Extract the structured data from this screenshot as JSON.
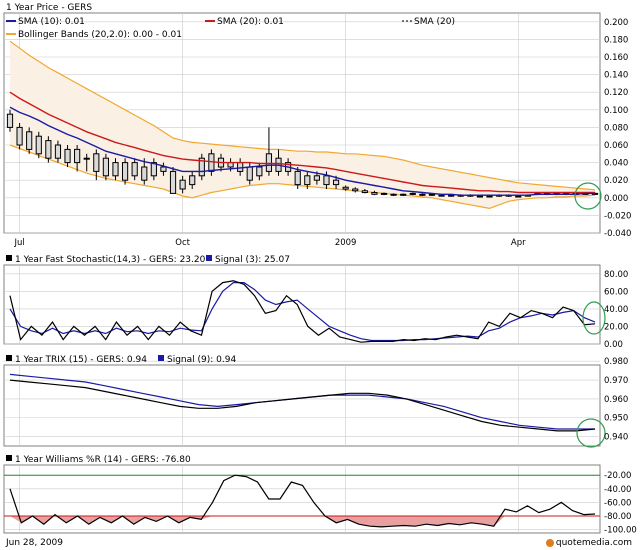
{
  "colors": {
    "frame": "#808080",
    "grid": "#cccccc",
    "sma10": "#1a1aa6",
    "sma20": "#cc1a1a",
    "bollinger": "#f0a830",
    "bollinger_fill": "#fbf0e4",
    "stoch_k": "#000000",
    "stoch_signal": "#1a1aa6",
    "trix": "#000000",
    "trix_signal": "#1a1aa6",
    "williams": "#000000",
    "williams_line_upper": "#228b22",
    "williams_line_lower": "#cc1a1a",
    "williams_fill": "#e8a0a0",
    "highlight_circle": "#2e9e4f"
  },
  "footer": {
    "date": "Jun 28, 2009",
    "brand": "quotemedia.com"
  },
  "price_panel": {
    "title": "1 Year Price - GERS",
    "legend": {
      "sma10": "SMA (10): 0.01",
      "sma20": "SMA (20): 0.01",
      "sma20_dotted": "SMA (20)",
      "bollinger": "Bollinger Bands (20,2.0): 0.00 - 0.01"
    },
    "x_labels": [
      "Jul",
      "Oct",
      "2009",
      "Apr"
    ],
    "y_labels": [
      "0.200",
      "0.180",
      "0.160",
      "0.140",
      "0.120",
      "0.100",
      "0.080",
      "0.060",
      "0.040",
      "0.020",
      "0.000",
      "-0.020",
      "-0.040"
    ]
  },
  "stoch_panel": {
    "title_prefix": "1 Year  Fast Stochastic(14,3) - GERS: 23.20",
    "signal_label": "Signal (3): 25.07",
    "y_labels": [
      "80.00",
      "60.00",
      "40.00",
      "20.00",
      "0.00"
    ]
  },
  "trix_panel": {
    "title_prefix": "1 Year TRIX (15) - GERS: 0.94",
    "signal_label": "Signal (9): 0.94",
    "y_labels": [
      "0.980",
      "0.970",
      "0.960",
      "0.950",
      "0.940"
    ]
  },
  "williams_panel": {
    "title": "1 Year Williams %R (14) - GERS: -76.80",
    "y_labels": [
      "-20.00",
      "-40.00",
      "-60.00",
      "-80.00",
      "-100.00"
    ]
  },
  "chart_data": [
    {
      "type": "candlestick",
      "title": "1 Year Price - GERS",
      "ylim": [
        -0.04,
        0.21
      ],
      "x_tick_labels": [
        "Jul",
        "Oct",
        "2009",
        "Apr"
      ],
      "x_tick_index": [
        1,
        18,
        35,
        53
      ],
      "candles": [
        {
          "o": 0.095,
          "c": 0.08,
          "h": 0.1,
          "l": 0.075
        },
        {
          "o": 0.08,
          "c": 0.06,
          "h": 0.085,
          "l": 0.055
        },
        {
          "o": 0.075,
          "c": 0.055,
          "h": 0.08,
          "l": 0.05
        },
        {
          "o": 0.07,
          "c": 0.05,
          "h": 0.075,
          "l": 0.045
        },
        {
          "o": 0.065,
          "c": 0.045,
          "h": 0.07,
          "l": 0.04
        },
        {
          "o": 0.06,
          "c": 0.045,
          "h": 0.065,
          "l": 0.04
        },
        {
          "o": 0.055,
          "c": 0.04,
          "h": 0.06,
          "l": 0.035
        },
        {
          "o": 0.055,
          "c": 0.04,
          "h": 0.06,
          "l": 0.03
        },
        {
          "o": 0.045,
          "c": 0.045,
          "h": 0.05,
          "l": 0.03
        },
        {
          "o": 0.05,
          "c": 0.03,
          "h": 0.055,
          "l": 0.02
        },
        {
          "o": 0.045,
          "c": 0.025,
          "h": 0.05,
          "l": 0.02
        },
        {
          "o": 0.04,
          "c": 0.025,
          "h": 0.045,
          "l": 0.02
        },
        {
          "o": 0.04,
          "c": 0.02,
          "h": 0.045,
          "l": 0.015
        },
        {
          "o": 0.04,
          "c": 0.025,
          "h": 0.045,
          "l": 0.02
        },
        {
          "o": 0.035,
          "c": 0.02,
          "h": 0.045,
          "l": 0.015
        },
        {
          "o": 0.04,
          "c": 0.025,
          "h": 0.045,
          "l": 0.02
        },
        {
          "o": 0.035,
          "c": 0.03,
          "h": 0.04,
          "l": 0.025
        },
        {
          "o": 0.03,
          "c": 0.005,
          "h": 0.035,
          "l": 0.005
        },
        {
          "o": 0.02,
          "c": 0.01,
          "h": 0.025,
          "l": 0.005
        },
        {
          "o": 0.025,
          "c": 0.015,
          "h": 0.03,
          "l": 0.01
        },
        {
          "o": 0.045,
          "c": 0.025,
          "h": 0.05,
          "l": 0.02
        },
        {
          "o": 0.05,
          "c": 0.03,
          "h": 0.055,
          "l": 0.025
        },
        {
          "o": 0.045,
          "c": 0.035,
          "h": 0.05,
          "l": 0.03
        },
        {
          "o": 0.04,
          "c": 0.035,
          "h": 0.045,
          "l": 0.03
        },
        {
          "o": 0.04,
          "c": 0.03,
          "h": 0.045,
          "l": 0.025
        },
        {
          "o": 0.035,
          "c": 0.02,
          "h": 0.04,
          "l": 0.015
        },
        {
          "o": 0.035,
          "c": 0.025,
          "h": 0.04,
          "l": 0.02
        },
        {
          "o": 0.05,
          "c": 0.03,
          "h": 0.08,
          "l": 0.025
        },
        {
          "o": 0.045,
          "c": 0.03,
          "h": 0.055,
          "l": 0.025
        },
        {
          "o": 0.04,
          "c": 0.03,
          "h": 0.045,
          "l": 0.025
        },
        {
          "o": 0.03,
          "c": 0.015,
          "h": 0.035,
          "l": 0.01
        },
        {
          "o": 0.025,
          "c": 0.015,
          "h": 0.03,
          "l": 0.01
        },
        {
          "o": 0.025,
          "c": 0.02,
          "h": 0.03,
          "l": 0.015
        },
        {
          "o": 0.025,
          "c": 0.015,
          "h": 0.03,
          "l": 0.01
        },
        {
          "o": 0.02,
          "c": 0.015,
          "h": 0.025,
          "l": 0.01
        },
        {
          "o": 0.012,
          "c": 0.01,
          "h": 0.014,
          "l": 0.008
        },
        {
          "o": 0.01,
          "c": 0.008,
          "h": 0.012,
          "l": 0.006
        },
        {
          "o": 0.008,
          "c": 0.006,
          "h": 0.01,
          "l": 0.005
        },
        {
          "o": 0.006,
          "c": 0.004,
          "h": 0.008,
          "l": 0.003
        },
        {
          "o": 0.005,
          "c": 0.004,
          "h": 0.006,
          "l": 0.003
        },
        {
          "o": 0.004,
          "c": 0.003,
          "h": 0.005,
          "l": 0.002
        },
        {
          "o": 0.004,
          "c": 0.003,
          "h": 0.005,
          "l": 0.002
        },
        {
          "o": 0.005,
          "c": 0.004,
          "h": 0.006,
          "l": 0.003
        },
        {
          "o": 0.004,
          "c": 0.003,
          "h": 0.005,
          "l": 0.002
        },
        {
          "o": 0.004,
          "c": 0.003,
          "h": 0.005,
          "l": 0.002
        },
        {
          "o": 0.003,
          "c": 0.003,
          "h": 0.004,
          "l": 0.002
        },
        {
          "o": 0.003,
          "c": 0.002,
          "h": 0.004,
          "l": 0.001
        },
        {
          "o": 0.003,
          "c": 0.002,
          "h": 0.004,
          "l": 0.001
        },
        {
          "o": 0.003,
          "c": 0.002,
          "h": 0.004,
          "l": 0.001
        },
        {
          "o": 0.002,
          "c": 0.002,
          "h": 0.003,
          "l": 0.001
        },
        {
          "o": 0.002,
          "c": 0.002,
          "h": 0.003,
          "l": 0.001
        },
        {
          "o": 0.003,
          "c": 0.002,
          "h": 0.004,
          "l": 0.001
        },
        {
          "o": 0.003,
          "c": 0.002,
          "h": 0.004,
          "l": 0.001
        },
        {
          "o": 0.002,
          "c": 0.002,
          "h": 0.003,
          "l": 0.001
        },
        {
          "o": 0.003,
          "c": 0.003,
          "h": 0.004,
          "l": 0.002
        },
        {
          "o": 0.005,
          "c": 0.004,
          "h": 0.006,
          "l": 0.003
        },
        {
          "o": 0.005,
          "c": 0.004,
          "h": 0.006,
          "l": 0.003
        },
        {
          "o": 0.005,
          "c": 0.004,
          "h": 0.006,
          "l": 0.003
        },
        {
          "o": 0.005,
          "c": 0.004,
          "h": 0.006,
          "l": 0.003
        },
        {
          "o": 0.005,
          "c": 0.004,
          "h": 0.006,
          "l": 0.003
        },
        {
          "o": 0.005,
          "c": 0.005,
          "h": 0.006,
          "l": 0.004
        },
        {
          "o": 0.005,
          "c": 0.005,
          "h": 0.006,
          "l": 0.004
        }
      ],
      "series": [
        {
          "name": "SMA (10)",
          "values": [
            0.103,
            0.097,
            0.093,
            0.088,
            0.082,
            0.077,
            0.072,
            0.068,
            0.063,
            0.058,
            0.053,
            0.05,
            0.047,
            0.044,
            0.041,
            0.039,
            0.036,
            0.033,
            0.03,
            0.03,
            0.03,
            0.031,
            0.032,
            0.033,
            0.034,
            0.035,
            0.036,
            0.037,
            0.037,
            0.035,
            0.032,
            0.03,
            0.028,
            0.026,
            0.023,
            0.02,
            0.018,
            0.016,
            0.014,
            0.012,
            0.01,
            0.008,
            0.007,
            0.006,
            0.005,
            0.004,
            0.004,
            0.003,
            0.003,
            0.003,
            0.003,
            0.003,
            0.003,
            0.003,
            0.003,
            0.004,
            0.004,
            0.004,
            0.004,
            0.004,
            0.005,
            0.005
          ]
        },
        {
          "name": "SMA (20)",
          "values": [
            0.12,
            0.113,
            0.107,
            0.101,
            0.095,
            0.09,
            0.085,
            0.08,
            0.075,
            0.071,
            0.067,
            0.063,
            0.06,
            0.057,
            0.054,
            0.051,
            0.048,
            0.046,
            0.044,
            0.043,
            0.042,
            0.041,
            0.04,
            0.04,
            0.04,
            0.04,
            0.039,
            0.039,
            0.039,
            0.038,
            0.037,
            0.036,
            0.035,
            0.034,
            0.032,
            0.03,
            0.028,
            0.026,
            0.024,
            0.022,
            0.02,
            0.018,
            0.016,
            0.014,
            0.013,
            0.012,
            0.011,
            0.01,
            0.009,
            0.008,
            0.008,
            0.007,
            0.007,
            0.006,
            0.006,
            0.006,
            0.006,
            0.006,
            0.006,
            0.006,
            0.006,
            0.006
          ]
        },
        {
          "name": "Bollinger Upper",
          "values": [
            0.178,
            0.17,
            0.162,
            0.155,
            0.148,
            0.142,
            0.136,
            0.13,
            0.124,
            0.118,
            0.112,
            0.106,
            0.1,
            0.094,
            0.088,
            0.082,
            0.075,
            0.068,
            0.065,
            0.063,
            0.062,
            0.061,
            0.06,
            0.059,
            0.058,
            0.057,
            0.056,
            0.055,
            0.055,
            0.054,
            0.053,
            0.053,
            0.052,
            0.052,
            0.051,
            0.05,
            0.05,
            0.049,
            0.048,
            0.047,
            0.045,
            0.043,
            0.04,
            0.037,
            0.035,
            0.033,
            0.031,
            0.029,
            0.027,
            0.025,
            0.023,
            0.021,
            0.019,
            0.017,
            0.016,
            0.015,
            0.014,
            0.013,
            0.012,
            0.011,
            0.01,
            0.009
          ]
        },
        {
          "name": "Bollinger Lower",
          "values": [
            0.06,
            0.056,
            0.052,
            0.048,
            0.044,
            0.04,
            0.036,
            0.032,
            0.028,
            0.025,
            0.022,
            0.02,
            0.018,
            0.016,
            0.014,
            0.012,
            0.01,
            0.006,
            0.002,
            0.0,
            0.003,
            0.006,
            0.008,
            0.01,
            0.012,
            0.014,
            0.015,
            0.016,
            0.016,
            0.015,
            0.014,
            0.013,
            0.012,
            0.011,
            0.01,
            0.009,
            0.008,
            0.007,
            0.006,
            0.005,
            0.004,
            0.003,
            0.002,
            0.001,
            0.0,
            -0.002,
            -0.004,
            -0.006,
            -0.008,
            -0.01,
            -0.012,
            -0.008,
            -0.004,
            -0.002,
            -0.001,
            0.0,
            0.0,
            0.001,
            0.001,
            0.002,
            0.002,
            0.003
          ]
        }
      ]
    },
    {
      "type": "line",
      "title": "1 Year  Fast Stochastic(14,3) - GERS: 23.20",
      "ylim": [
        0,
        90
      ],
      "series": [
        {
          "name": "Fast Stochastic",
          "values": [
            55,
            5,
            20,
            10,
            25,
            5,
            20,
            10,
            20,
            5,
            25,
            10,
            20,
            5,
            20,
            10,
            25,
            15,
            10,
            60,
            70,
            72,
            68,
            55,
            35,
            38,
            55,
            45,
            20,
            10,
            18,
            8,
            5,
            2,
            3,
            3,
            3,
            5,
            4,
            6,
            5,
            8,
            10,
            8,
            6,
            25,
            20,
            35,
            30,
            38,
            35,
            30,
            42,
            38,
            22,
            23
          ]
        },
        {
          "name": "Signal (3)",
          "values": [
            40,
            20,
            15,
            12,
            18,
            12,
            15,
            12,
            15,
            12,
            18,
            14,
            15,
            12,
            15,
            14,
            18,
            16,
            15,
            40,
            60,
            70,
            70,
            62,
            50,
            45,
            48,
            50,
            40,
            30,
            20,
            15,
            10,
            6,
            4,
            4,
            4,
            4,
            5,
            5,
            6,
            7,
            8,
            9,
            8,
            15,
            18,
            25,
            30,
            32,
            35,
            33,
            36,
            38,
            30,
            25
          ]
        }
      ]
    },
    {
      "type": "line",
      "title": "1 Year TRIX (15) - GERS: 0.94",
      "ylim": [
        0.935,
        0.978
      ],
      "series": [
        {
          "name": "TRIX (15)",
          "values": [
            0.97,
            0.969,
            0.968,
            0.967,
            0.966,
            0.964,
            0.962,
            0.96,
            0.958,
            0.956,
            0.955,
            0.955,
            0.956,
            0.958,
            0.959,
            0.96,
            0.961,
            0.962,
            0.963,
            0.963,
            0.962,
            0.96,
            0.957,
            0.954,
            0.951,
            0.948,
            0.946,
            0.945,
            0.944,
            0.943,
            0.943,
            0.944
          ]
        },
        {
          "name": "Signal (9)",
          "values": [
            0.973,
            0.972,
            0.971,
            0.97,
            0.969,
            0.967,
            0.965,
            0.963,
            0.961,
            0.959,
            0.957,
            0.956,
            0.957,
            0.958,
            0.959,
            0.96,
            0.961,
            0.962,
            0.962,
            0.962,
            0.961,
            0.96,
            0.958,
            0.956,
            0.953,
            0.95,
            0.948,
            0.946,
            0.945,
            0.944,
            0.944,
            0.944
          ]
        }
      ]
    },
    {
      "type": "line",
      "title": "1 Year Williams %R (14) - GERS: -76.80",
      "ylim": [
        -105,
        -5
      ],
      "reference_lines": [
        -20,
        -80
      ],
      "series": [
        {
          "name": "Williams %R (14)",
          "values": [
            -40,
            -90,
            -80,
            -92,
            -78,
            -90,
            -80,
            -92,
            -82,
            -90,
            -80,
            -92,
            -82,
            -88,
            -80,
            -90,
            -82,
            -85,
            -60,
            -28,
            -20,
            -22,
            -30,
            -55,
            -55,
            -30,
            -35,
            -60,
            -80,
            -90,
            -85,
            -92,
            -95,
            -96,
            -95,
            -94,
            -95,
            -92,
            -94,
            -91,
            -93,
            -90,
            -92,
            -95,
            -70,
            -74,
            -65,
            -75,
            -70,
            -60,
            -72,
            -78,
            -77
          ]
        }
      ]
    }
  ]
}
